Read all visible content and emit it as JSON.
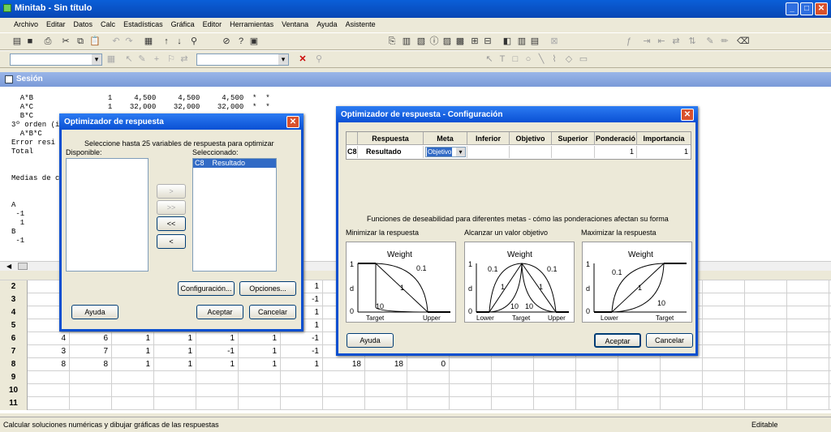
{
  "window": {
    "title": "Minitab - Sin título"
  },
  "menu": [
    "Archivo",
    "Editar",
    "Datos",
    "Calc",
    "Estadísticas",
    "Gráfica",
    "Editor",
    "Herramientas",
    "Ventana",
    "Ayuda",
    "Asistente"
  ],
  "session": {
    "title": "Sesión",
    "lines": [
      "  A*B                 1     4,500     4,500     4,500  *  *",
      "  A*C                 1    32,000    32,000    32,000  *  *",
      "  B*C",
      "3º orden (i",
      "  A*B*C",
      "Error resi",
      "Total",
      "",
      "",
      "Medias de c",
      "",
      "",
      "A",
      " -1",
      "  1",
      "B",
      " -1"
    ]
  },
  "grid": {
    "rows": [
      {
        "n": "2",
        "cells": [
          "",
          "",
          "",
          "",
          "",
          "",
          "1",
          "",
          "",
          ""
        ]
      },
      {
        "n": "3",
        "cells": [
          "",
          "",
          "",
          "",
          "",
          "",
          "-1",
          "",
          "",
          ""
        ]
      },
      {
        "n": "4",
        "cells": [
          "",
          "",
          "",
          "",
          "",
          "",
          "1",
          "",
          "",
          ""
        ]
      },
      {
        "n": "5",
        "cells": [
          "",
          "",
          "",
          "",
          "",
          "",
          "1",
          "",
          "",
          ""
        ]
      },
      {
        "n": "6",
        "cells": [
          "4",
          "6",
          "1",
          "1",
          "1",
          "1",
          "-1",
          "",
          "",
          ""
        ]
      },
      {
        "n": "7",
        "cells": [
          "3",
          "7",
          "1",
          "1",
          "-1",
          "1",
          "-1",
          "",
          "",
          ""
        ]
      },
      {
        "n": "8",
        "cells": [
          "8",
          "8",
          "1",
          "1",
          "1",
          "1",
          "1",
          "18",
          "18",
          "0"
        ]
      },
      {
        "n": "9",
        "cells": [
          "",
          "",
          "",
          "",
          "",
          "",
          "",
          "",
          "",
          ""
        ]
      },
      {
        "n": "10",
        "cells": [
          "",
          "",
          "",
          "",
          "",
          "",
          "",
          "",
          "",
          ""
        ]
      },
      {
        "n": "11",
        "cells": [
          "",
          "",
          "",
          "",
          "",
          "",
          "",
          "",
          "",
          ""
        ]
      }
    ]
  },
  "status": {
    "text": "Calcular soluciones numéricas y dibujar gráficas de las respuestas",
    "mode": "Editable"
  },
  "optimizer": {
    "title": "Optimizador de respuesta",
    "instruction": "Seleccione hasta 25 variables de respuesta para optimizar",
    "available_label": "Disponible:",
    "selected_label": "Seleccionado:",
    "selected_item_col": "C8",
    "selected_item_name": "Resultado",
    "move_buttons": [
      ">",
      ">>",
      "<<",
      "<"
    ],
    "config_button": "Configuración...",
    "options_button": "Opciones...",
    "help_button": "Ayuda",
    "ok_button": "Aceptar",
    "cancel_button": "Cancelar"
  },
  "config": {
    "title": "Optimizador de respuesta - Configuración",
    "headers": [
      "Respuesta",
      "Meta",
      "Inferior",
      "Objetivo",
      "Superior",
      "Ponderació",
      "Importancia"
    ],
    "row": {
      "col": "C8",
      "name": "Resultado",
      "goal": "Objetivo",
      "lower": "",
      "target": "",
      "upper": "",
      "weight": "1",
      "importance": "1"
    },
    "desc": "Funciones de deseabilidad para diferentes metas - cómo las ponderaciones afectan su forma",
    "panels": [
      {
        "label": "Minimizar la respuesta",
        "weight": "Weight",
        "w1": "0.1",
        "w2": "1",
        "w3": "10",
        "x1": "Target",
        "x2": "Upper"
      },
      {
        "label": "Alcanzar un valor objetivo",
        "weight": "Weight",
        "w1": "0.1",
        "w2": "1",
        "w3": "10",
        "x1": "Lower",
        "x2": "Target",
        "x3": "Upper"
      },
      {
        "label": "Maximizar la respuesta",
        "weight": "Weight",
        "w1": "0.1",
        "w2": "1",
        "w3": "10",
        "x1": "Lower",
        "x2": "Target"
      }
    ],
    "y1": "1",
    "y0": "0",
    "d": "d",
    "help_button": "Ayuda",
    "ok_button": "Aceptar",
    "cancel_button": "Cancelar"
  }
}
